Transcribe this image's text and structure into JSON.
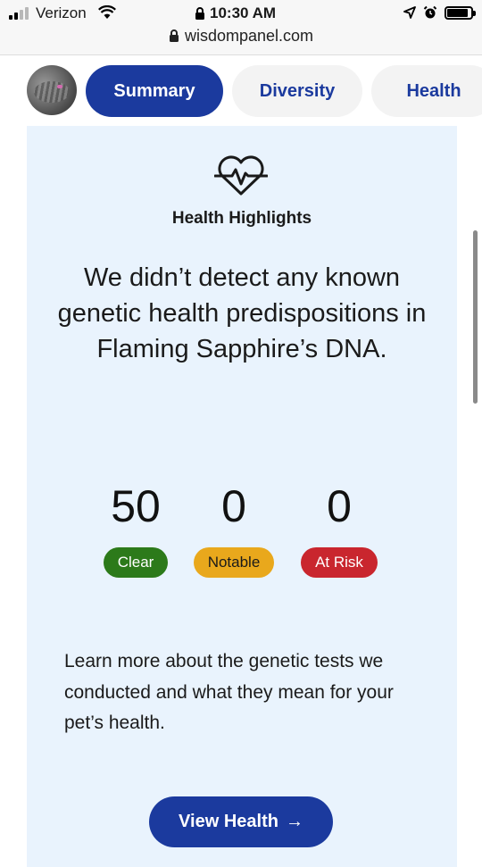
{
  "status_bar": {
    "carrier": "Verizon",
    "time": "10:30 AM",
    "icons": [
      "signal-icon",
      "wifi-icon",
      "lock-icon",
      "location-arrow-icon",
      "alarm-icon",
      "battery-icon"
    ],
    "battery_level": 0.9
  },
  "browser": {
    "url": "wisdompanel.com"
  },
  "tabs": [
    {
      "label": "Summary",
      "active": true
    },
    {
      "label": "Diversity",
      "active": false
    },
    {
      "label": "Health",
      "active": false
    }
  ],
  "health": {
    "title": "Health Highlights",
    "headline": "We didn’t detect any known genetic health predispositions in Flaming Sapphire’s DNA.",
    "stats": [
      {
        "value": "50",
        "label": "Clear",
        "color": "#2c7a1a"
      },
      {
        "value": "0",
        "label": "Notable",
        "color": "#e9a81c"
      },
      {
        "value": "0",
        "label": "At Risk",
        "color": "#c9262e"
      }
    ],
    "learn_more": "Learn more about the genetic tests we conducted and what they mean for your pet’s health.",
    "cta_label": "View Health",
    "cta_arrow": "→"
  },
  "colors": {
    "brand_blue": "#1b3a9e",
    "card_bg": "#e9f3fd"
  }
}
